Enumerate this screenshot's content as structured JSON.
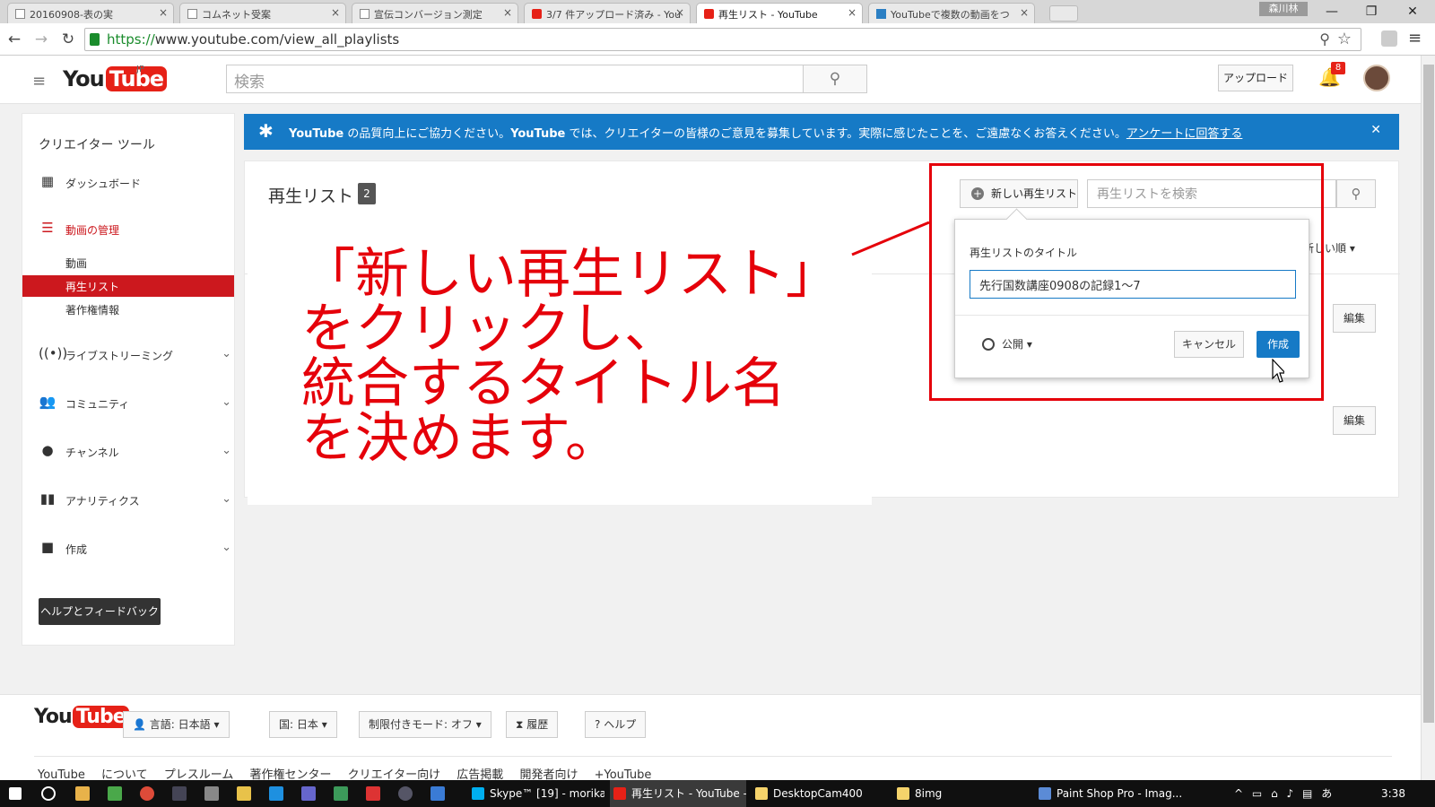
{
  "browser": {
    "tabs": [
      {
        "label": "20160908-表の実",
        "icon": "doc-icon",
        "active": false
      },
      {
        "label": "コムネット受案",
        "icon": "doc-icon",
        "active": false
      },
      {
        "label": "宣伝コンバージョン測定",
        "icon": "doc-icon",
        "active": false
      },
      {
        "label": "3/7 件アップロード済み - You",
        "icon": "youtube-icon",
        "active": false
      },
      {
        "label": "再生リスト - YouTube",
        "icon": "youtube-icon",
        "active": true
      },
      {
        "label": "YouTubeで複数の動画をつ",
        "icon": "dk-icon",
        "active": false
      }
    ],
    "user_badge": "森川林",
    "url_scheme": "https://",
    "url_rest": "www.youtube.com/view_all_playlists"
  },
  "header": {
    "logo_you": "You",
    "logo_tube": "Tube",
    "logo_region": "JP",
    "search_placeholder": "検索",
    "upload_label": "アップロード",
    "notification_count": "8"
  },
  "sidebar": {
    "title": "クリエイター ツール",
    "dashboard": "ダッシュボード",
    "video_manager": "動画の管理",
    "sub_items": [
      "動画",
      "再生リスト",
      "著作権情報"
    ],
    "live": "ライブストリーミング",
    "community": "コミュニティ",
    "channel": "チャンネル",
    "analytics": "アナリティクス",
    "create": "作成",
    "help_button": "ヘルプとフィードバック"
  },
  "banner": {
    "brand1": "YouTube",
    "text1": " の品質向上にご協力ください。",
    "brand2": "YouTube",
    "text2": " では、クリエイターの皆様のご意見を募集しています。実際に感じたことを、ご遠慮なくお答えください。",
    "link": "アンケートに回答する"
  },
  "main": {
    "title": "再生リスト",
    "count": "2",
    "new_playlist": "新しい再生リスト",
    "search_placeholder": "再生リストを検索",
    "sort_label": "新しい順",
    "edit_label": "編集"
  },
  "popup": {
    "label": "再生リストのタイトル",
    "input_value": "先行国数講座0908の記録1〜7",
    "privacy": "公開",
    "cancel": "キャンセル",
    "create": "作成"
  },
  "annotation": {
    "line1": "「新しい再生リスト」",
    "line2": "をクリックし、",
    "line3": "統合するタイトル名",
    "line4": "を決めます。",
    "color": "#e5000a"
  },
  "footer": {
    "logo_you": "You",
    "logo_tube": "Tube",
    "language": "言語: 日本語",
    "country": "国: 日本",
    "restricted": "制限付きモード: オフ",
    "history": "履歴",
    "help": "ヘルプ",
    "links": [
      "YouTube について",
      "プレスルーム",
      "著作権センター",
      "クリエイター向け",
      "広告掲載",
      "開発者向け",
      "+YouTube"
    ]
  },
  "taskbar": {
    "apps": [
      {
        "label": "Skype™ [19] - morika...",
        "color": "#00aff0"
      },
      {
        "label": "再生リスト - YouTube -...",
        "color": "#e62117"
      },
      {
        "label": "DesktopCam400",
        "color": "#f5d36b"
      },
      {
        "label": "8img",
        "color": "#f5d36b"
      },
      {
        "label": "Paint Shop Pro - Imag...",
        "color": "#5b8bd6"
      }
    ],
    "ime": "あ",
    "clock": "3:38"
  }
}
